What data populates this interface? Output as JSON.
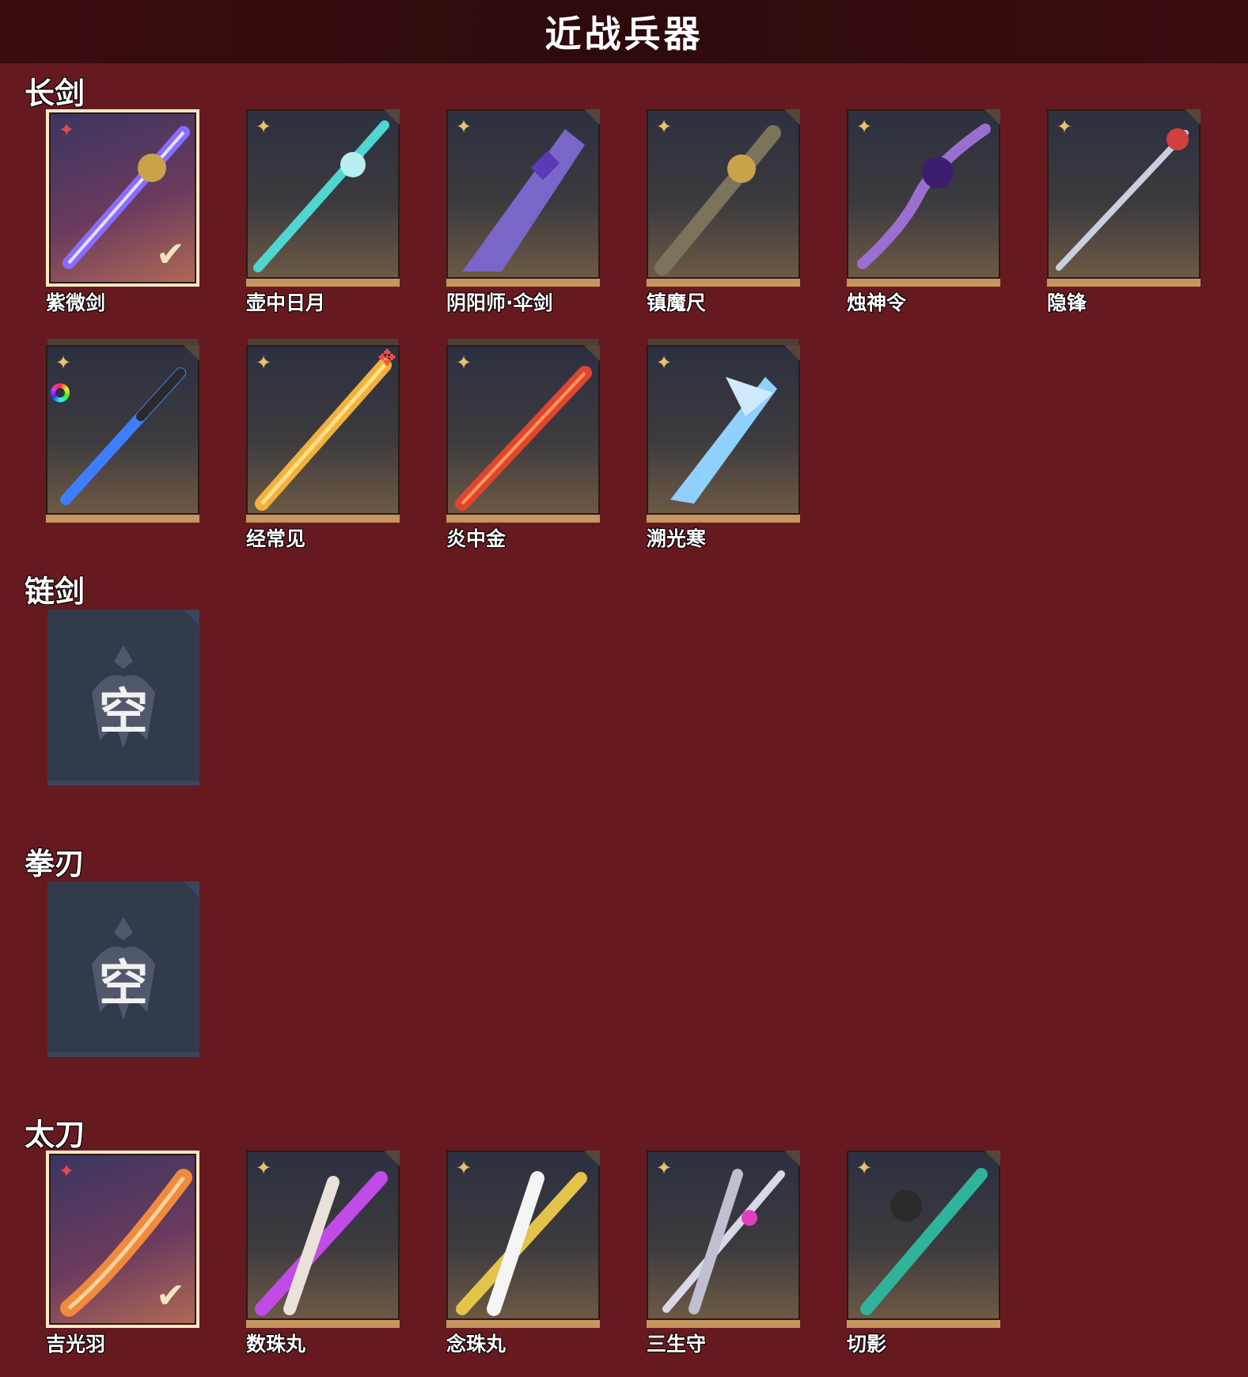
{
  "header": {
    "title": "近战兵器"
  },
  "sections": {
    "longsword": {
      "label": "长剑",
      "items": [
        {
          "name": "紫微剑",
          "equipped": true,
          "color": "#8a6cff"
        },
        {
          "name": "壶中日月",
          "equipped": false,
          "color": "#4fd6d0"
        },
        {
          "name": "阴阳师·伞剑",
          "equipped": false,
          "color": "#7a66c9"
        },
        {
          "name": "镇魔尺",
          "equipped": false,
          "color": "#c9a24a"
        },
        {
          "name": "烛神令",
          "equipped": false,
          "color": "#9b6fd0"
        },
        {
          "name": "隐锋",
          "equipped": false,
          "color": "#c8d0e0"
        },
        {
          "name": "",
          "equipped": false,
          "color": "#3f7dff"
        },
        {
          "name": "经常见",
          "equipped": false,
          "color": "#f2b13c"
        },
        {
          "name": "炎中金",
          "equipped": false,
          "color": "#e0452f"
        },
        {
          "name": "溯光寒",
          "equipped": false,
          "color": "#8fd0ff"
        }
      ]
    },
    "chain_sword": {
      "label": "链剑",
      "empty_text": "空"
    },
    "fist_blade": {
      "label": "拳刃",
      "empty_text": "空"
    },
    "tachi": {
      "label": "太刀",
      "items": [
        {
          "name": "吉光羽",
          "equipped": true,
          "color": "#f08a3c"
        },
        {
          "name": "数珠丸",
          "equipped": false,
          "color": "#c04be6"
        },
        {
          "name": "念珠丸",
          "equipped": false,
          "color": "#e3c34a"
        },
        {
          "name": "三生守",
          "equipped": false,
          "color": "#d8d8e8"
        },
        {
          "name": "切影",
          "equipped": false,
          "color": "#2fb39a"
        }
      ]
    }
  },
  "icons": {
    "rarity": "four-point-star-icon",
    "equipped": "checkmark-icon",
    "upgrade": "red-flame-icon",
    "dye": "rainbow-ring-icon"
  }
}
